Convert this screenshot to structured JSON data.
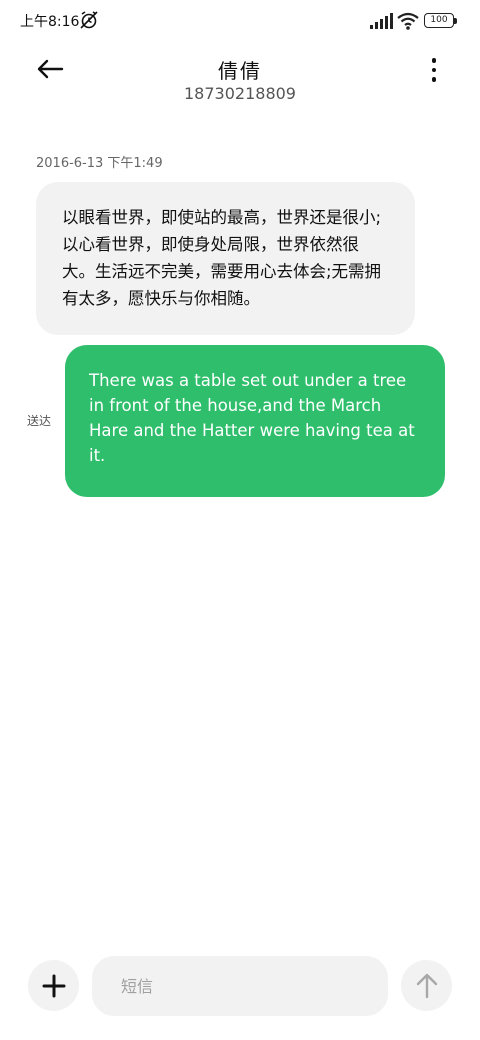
{
  "status_bar": {
    "time": "上午8:16",
    "battery": "100",
    "icons": [
      "alarm-off-icon",
      "signal-icon",
      "wifi-icon",
      "battery-icon"
    ]
  },
  "header": {
    "contact_name": "倩倩",
    "phone_number": "18730218809",
    "back_icon": "arrow-left-icon",
    "menu_icon": "more-vertical-icon"
  },
  "conversation": {
    "timestamp": "2016-6-13 下午1:49",
    "incoming_message": "以眼看世界，即使站的最高，世界还是很小;以心看世界，即使身处局限，世界依然很大。生活远不完美，需要用心去体会;无需拥有太多，愿快乐与你相随。",
    "outgoing_message": "There was a table set out under a tree in front of the house,and the March Hare and the Hatter were having tea at it.",
    "outgoing_status": "送达"
  },
  "composer": {
    "placeholder": "短信",
    "add_icon": "plus-icon",
    "send_icon": "arrow-up-icon"
  },
  "colors": {
    "outgoing_bubble": "#2fbf6c",
    "incoming_bubble": "#f2f2f2",
    "background": "#ffffff"
  }
}
